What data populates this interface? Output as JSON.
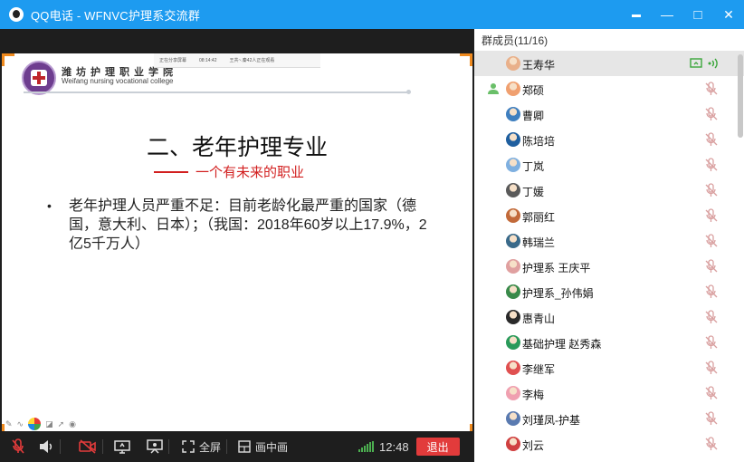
{
  "window": {
    "title": "QQ电话 - WFNVC护理系交流群",
    "controls": {
      "pin": "▬",
      "minimize": "—",
      "maximize": "□",
      "close": "✕"
    }
  },
  "slide": {
    "college_cn": "潍坊护理职业学院",
    "college_en": "Weifang nursing vocational college",
    "overlay": {
      "left": "正在分享屏幕",
      "time": "08:14:42",
      "right": "王共~.秦42人正在观看"
    },
    "title": "二、老年护理专业",
    "subtitle": "一个有未来的职业",
    "bullet_marker": "•",
    "bullet": "老年护理人员严重不足：目前老龄化最严重的国家（德国，意大利、日本）；（我国：2018年60岁以上17.9%，2亿5千万人）"
  },
  "controls": {
    "fullscreen": "全屏",
    "pip": "画中画",
    "time": "12:48",
    "exit": "退出",
    "signal_bars": [
      3,
      5,
      7,
      9,
      11,
      12
    ]
  },
  "members": {
    "header": "群成员(11/16)",
    "list": [
      {
        "name": "王寿华",
        "color": "#e9b08a",
        "selected": true,
        "screen": true
      },
      {
        "name": "郑硕",
        "color": "#f0a070",
        "mark": true
      },
      {
        "name": "曹卿",
        "color": "#3f7fbf"
      },
      {
        "name": "陈培培",
        "color": "#1f5f9f"
      },
      {
        "name": "丁岚",
        "color": "#7fb0e0"
      },
      {
        "name": "丁媛",
        "color": "#5a5a5a"
      },
      {
        "name": "郭丽红",
        "color": "#c26a3a"
      },
      {
        "name": "韩瑞兰",
        "color": "#3a6a8a"
      },
      {
        "name": "护理系  王庆平",
        "color": "#e0a0a0"
      },
      {
        "name": "护理系_孙伟娟",
        "color": "#3a8a4a"
      },
      {
        "name": "惠青山",
        "color": "#2a2a2a"
      },
      {
        "name": "基础护理 赵秀森",
        "color": "#2a9a5a"
      },
      {
        "name": "李继军",
        "color": "#e05050"
      },
      {
        "name": "李梅",
        "color": "#f0a0b0"
      },
      {
        "name": "刘瑾凤-护基",
        "color": "#5a7ab0"
      },
      {
        "name": "刘云",
        "color": "#d04040"
      }
    ]
  }
}
